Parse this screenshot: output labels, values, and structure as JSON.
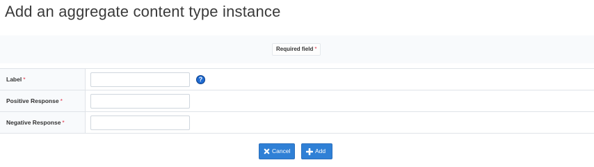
{
  "page": {
    "title": "Add an aggregate content type instance"
  },
  "legend": {
    "required_label": "Required field",
    "required_marker": "*"
  },
  "form": {
    "fields": [
      {
        "label": "Label",
        "required_marker": "*",
        "value": "",
        "has_help": true
      },
      {
        "label": "Positive Response",
        "required_marker": "*",
        "value": ""
      },
      {
        "label": "Negative Response",
        "required_marker": "*",
        "value": ""
      }
    ],
    "help_icon": "question-circle-icon"
  },
  "actions": {
    "cancel_label": "Cancel",
    "cancel_icon": "x-icon",
    "add_label": "Add",
    "add_icon": "plus-icon"
  },
  "colors": {
    "accent": "#2f80d6",
    "required": "#e0344a"
  }
}
